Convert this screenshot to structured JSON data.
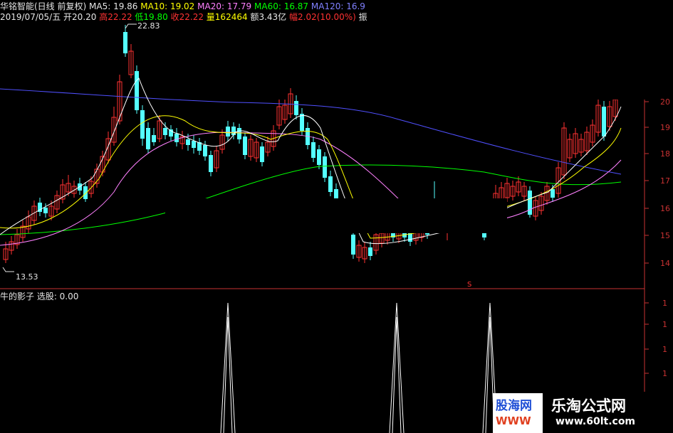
{
  "header": {
    "stock_title": "华铭智能(日线 前复权)",
    "ma5": "MA5: 19.86",
    "ma10": "MA10: 19.02",
    "ma20": "MA20: 17.79",
    "ma60": "MA60: 16.87",
    "ma120": "MA120: 16.9",
    "date": "2019/07/05/五",
    "open": "开20.20",
    "high": "高22.22",
    "low": "低19.80",
    "close": "收22.22",
    "volume": "量162464",
    "amount": "额3.43亿",
    "change": "幅2.02(10.00%)",
    "trail": "振"
  },
  "indicator": {
    "label": "牛的影子  选股: 0.00"
  },
  "price_tags": {
    "high_tag": "22.83",
    "low_tag": "13.53",
    "marker": "S"
  },
  "right_axis": {
    "price_ticks": [
      "20",
      "19",
      "18",
      "17",
      "16",
      "15",
      "14"
    ],
    "indicator_ticks": [
      "1",
      "1",
      "1",
      "1"
    ]
  },
  "watermarks": {
    "left_title": "股海网",
    "left_url": "WWW",
    "right_title": "乐淘公式网",
    "right_url": "www.60lt.com"
  },
  "colors": {
    "background": "#000000",
    "up_candle": "#ff3232",
    "down_candle": "#54ffff",
    "ma5": "#ffffff",
    "ma10": "#ffff00",
    "ma20": "#ff80ff",
    "ma60": "#00ff00",
    "ma120": "#5050ff",
    "axis_red": "#c83232",
    "indicator_line": "#ffffff"
  }
}
